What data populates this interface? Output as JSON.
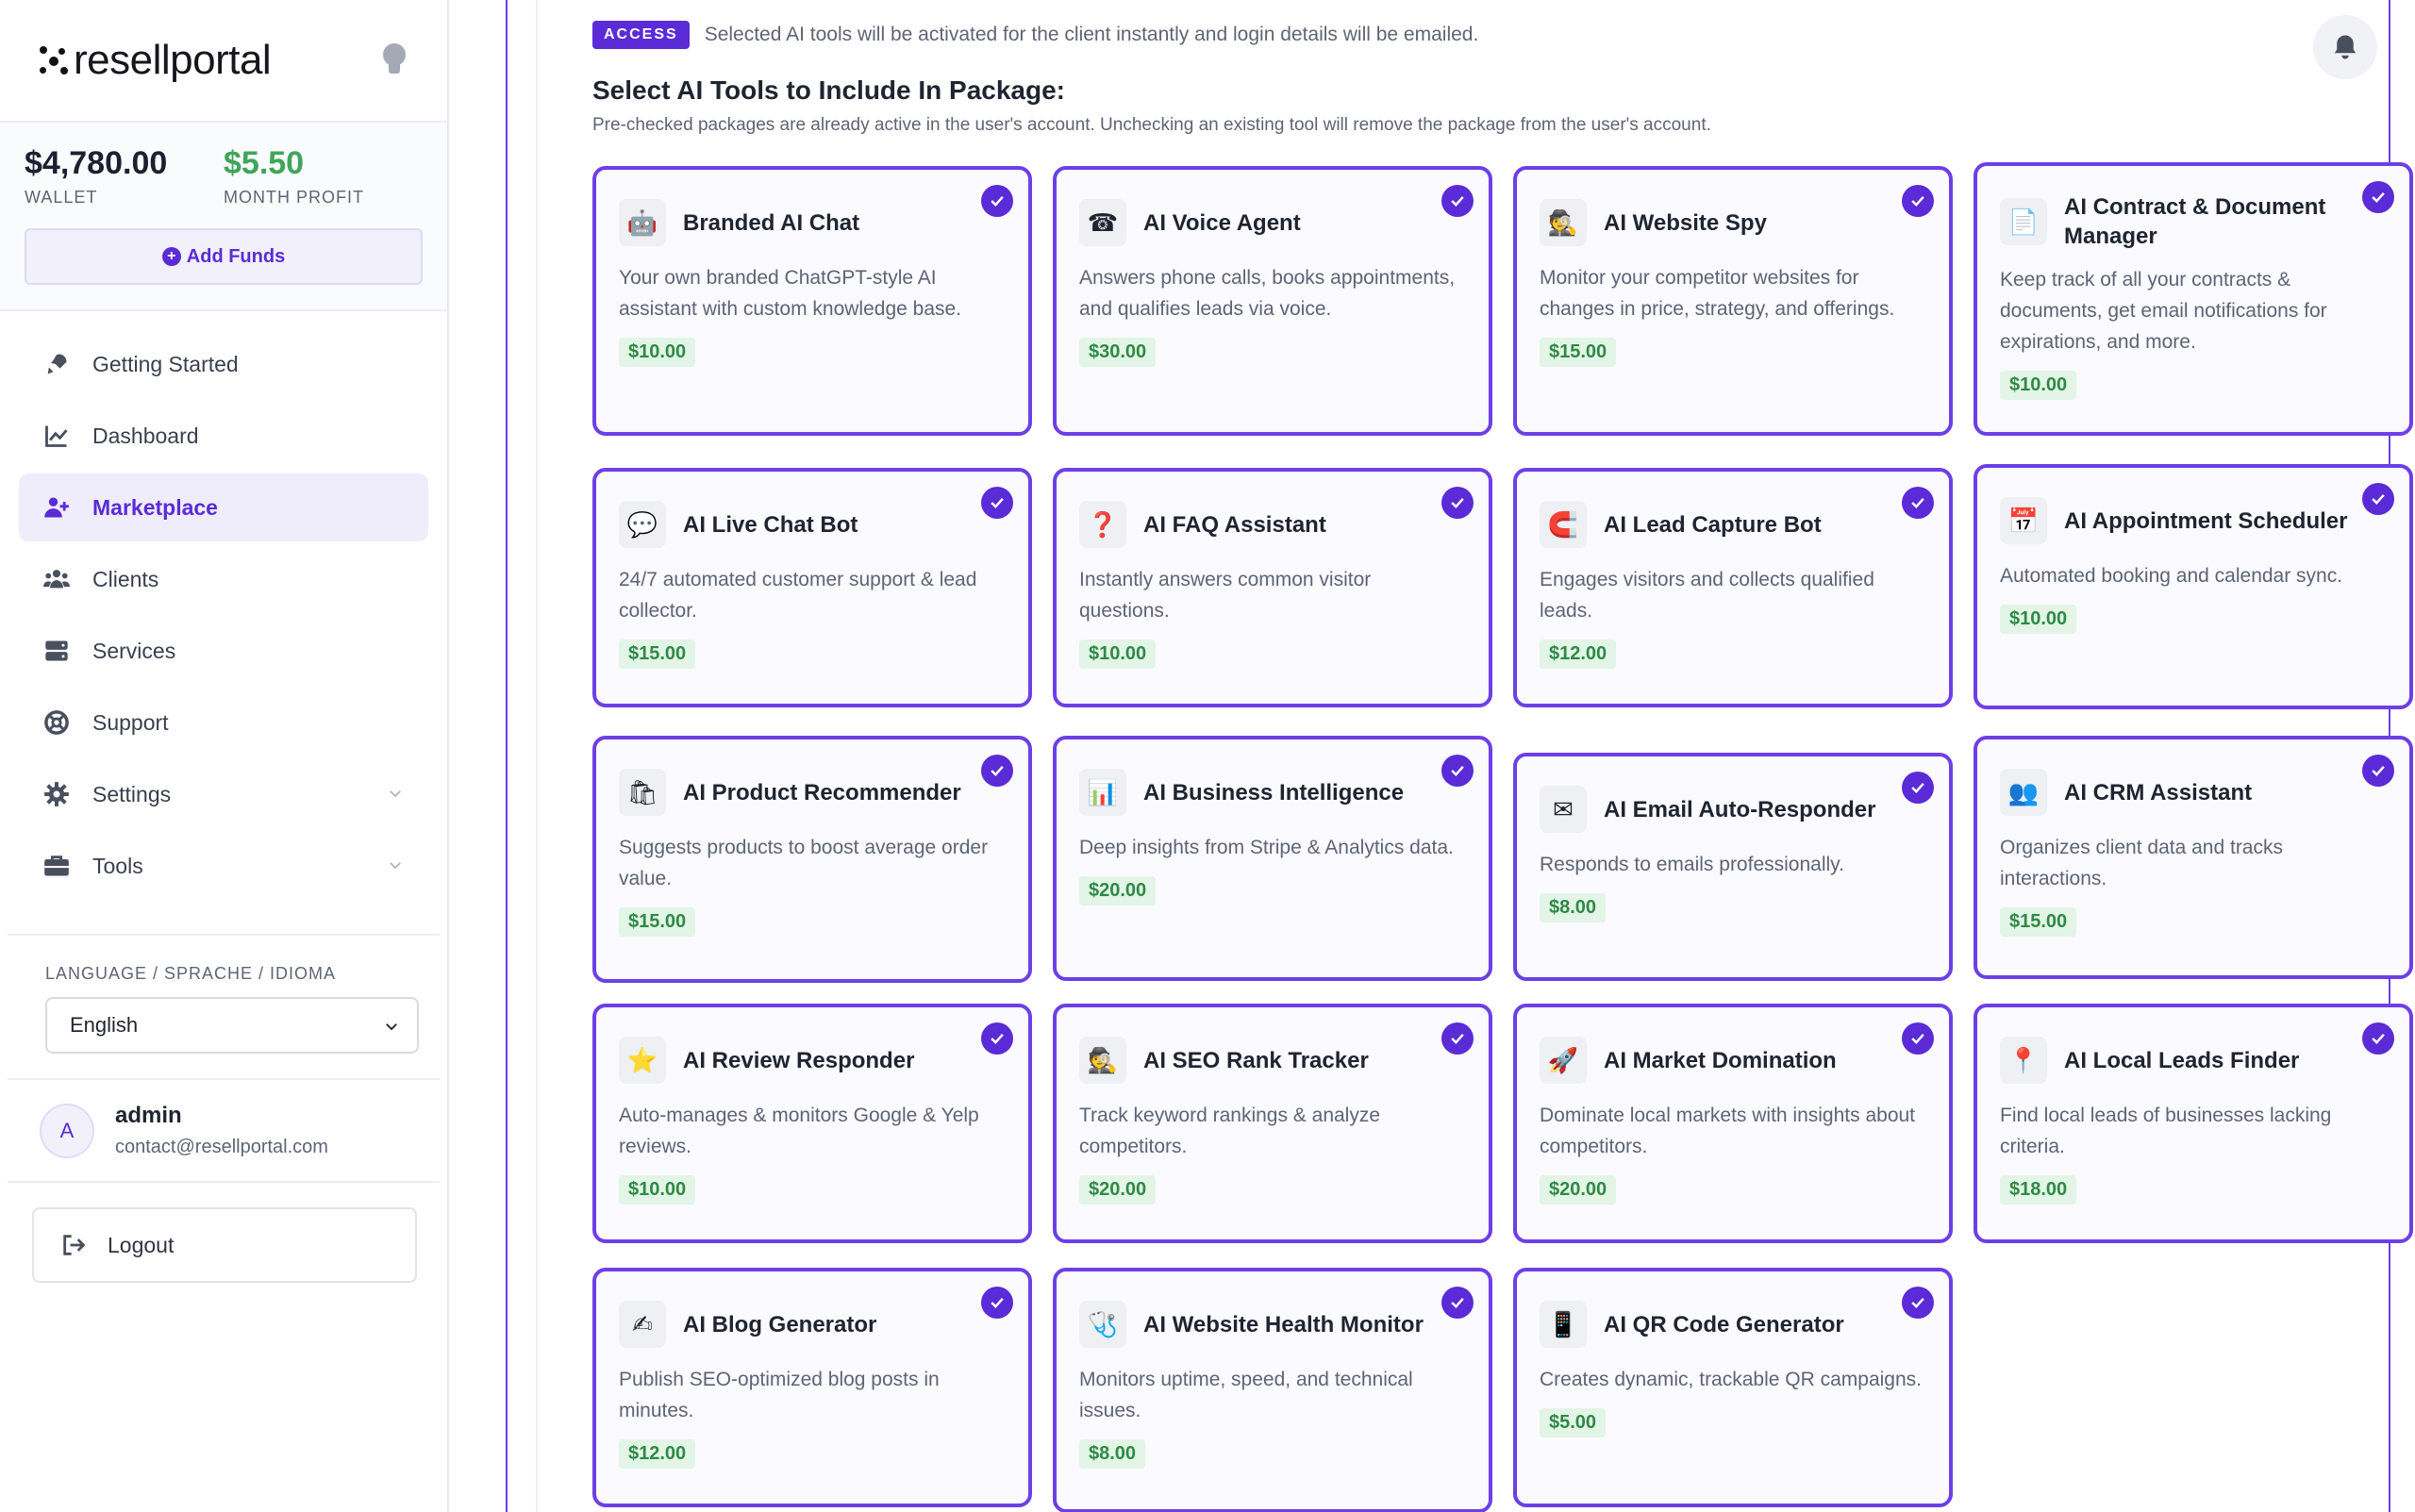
{
  "brand": {
    "name": "resellportal"
  },
  "wallet": {
    "amount": "$4,780.00",
    "label": "WALLET",
    "profit": "$5.50",
    "profit_label": "MONTH PROFIT",
    "add_funds": "Add Funds"
  },
  "nav": [
    {
      "label": "Getting Started",
      "icon": "rocket-icon"
    },
    {
      "label": "Dashboard",
      "icon": "chart-line-icon"
    },
    {
      "label": "Marketplace",
      "icon": "user-plus-icon"
    },
    {
      "label": "Clients",
      "icon": "users-icon"
    },
    {
      "label": "Services",
      "icon": "server-icon"
    },
    {
      "label": "Support",
      "icon": "lifebuoy-icon"
    },
    {
      "label": "Settings",
      "icon": "gear-icon"
    },
    {
      "label": "Tools",
      "icon": "toolbox-icon"
    }
  ],
  "language": {
    "label": "LANGUAGE / SPRACHE / IDIOMA",
    "selected": "English"
  },
  "user": {
    "initial": "A",
    "name": "admin",
    "email": "contact@resellportal.com"
  },
  "logout": "Logout",
  "access": {
    "badge": "ACCESS",
    "text": "Selected AI tools will be activated for the client instantly and login details will be emailed."
  },
  "section": {
    "title": "Select AI Tools to Include In Package:",
    "subtitle": "Pre-checked packages are already active in the user's account. Unchecking an existing tool will remove the package from the user's account."
  },
  "tools": [
    {
      "title": "Branded AI Chat",
      "desc": "Your own branded ChatGPT-style AI assistant with custom knowledge base.",
      "price": "$10.00",
      "icon": "robot-icon",
      "glyph": "🤖"
    },
    {
      "title": "AI Voice Agent",
      "desc": "Answers phone calls, books appointments, and qualifies leads via voice.",
      "price": "$30.00",
      "icon": "telephone-icon",
      "glyph": "☎"
    },
    {
      "title": "AI Website Spy",
      "desc": "Monitor your competitor websites for changes in price, strategy, and offerings.",
      "price": "$15.00",
      "icon": "spy-icon",
      "glyph": "🕵"
    },
    {
      "title": "AI Contract & Document Manager",
      "desc": "Keep track of all your contracts & documents, get email notifications for expirations, and more.",
      "price": "$10.00",
      "icon": "document-icon",
      "glyph": "📄"
    },
    {
      "title": "AI Live Chat Bot",
      "desc": "24/7 automated customer support & lead collector.",
      "price": "$15.00",
      "icon": "chat-bubble-icon",
      "glyph": "💬"
    },
    {
      "title": "AI FAQ Assistant",
      "desc": "Instantly answers common visitor questions.",
      "price": "$10.00",
      "icon": "question-icon",
      "glyph": "❓"
    },
    {
      "title": "AI Lead Capture Bot",
      "desc": "Engages visitors and collects qualified leads.",
      "price": "$12.00",
      "icon": "magnet-icon",
      "glyph": "🧲"
    },
    {
      "title": "AI Appointment Scheduler",
      "desc": "Automated booking and calendar sync.",
      "price": "$10.00",
      "icon": "calendar-icon",
      "glyph": "📅"
    },
    {
      "title": "AI Product Recommender",
      "desc": "Suggests products to boost average order value.",
      "price": "$15.00",
      "icon": "shopping-bag-icon",
      "glyph": "🛍"
    },
    {
      "title": "AI Business Intelligence",
      "desc": "Deep insights from Stripe & Analytics data.",
      "price": "$20.00",
      "icon": "bar-chart-icon",
      "glyph": "📊"
    },
    {
      "title": "AI Email Auto-Responder",
      "desc": "Responds to emails professionally.",
      "price": "$8.00",
      "icon": "envelope-icon",
      "glyph": "✉"
    },
    {
      "title": "AI CRM Assistant",
      "desc": "Organizes client data and tracks interactions.",
      "price": "$15.00",
      "icon": "people-icon",
      "glyph": "👥"
    },
    {
      "title": "AI Review Responder",
      "desc": "Auto-manages & monitors Google & Yelp reviews.",
      "price": "$10.00",
      "icon": "star-icon",
      "glyph": "⭐"
    },
    {
      "title": "AI SEO Rank Tracker",
      "desc": "Track keyword rankings & analyze competitors.",
      "price": "$20.00",
      "icon": "spy-icon",
      "glyph": "🕵"
    },
    {
      "title": "AI Market Domination",
      "desc": "Dominate local markets with insights about competitors.",
      "price": "$20.00",
      "icon": "rocket-icon",
      "glyph": "🚀"
    },
    {
      "title": "AI Local Leads Finder",
      "desc": "Find local leads of businesses lacking criteria.",
      "price": "$18.00",
      "icon": "pin-icon",
      "glyph": "📍"
    },
    {
      "title": "AI Blog Generator",
      "desc": "Publish SEO-optimized blog posts in minutes.",
      "price": "$12.00",
      "icon": "writing-hand-icon",
      "glyph": "✍"
    },
    {
      "title": "AI Website Health Monitor",
      "desc": "Monitors uptime, speed, and technical issues.",
      "price": "$8.00",
      "icon": "stethoscope-icon",
      "glyph": "🩺"
    },
    {
      "title": "AI QR Code Generator",
      "desc": "Creates dynamic, trackable QR campaigns.",
      "price": "$5.00",
      "icon": "mobile-phone-icon",
      "glyph": "📱"
    }
  ],
  "colors": {
    "accent": "#5a2bd6",
    "card_border": "#6d3fe6",
    "profit": "#3fa55a",
    "price_bg": "#e3f5e6"
  }
}
